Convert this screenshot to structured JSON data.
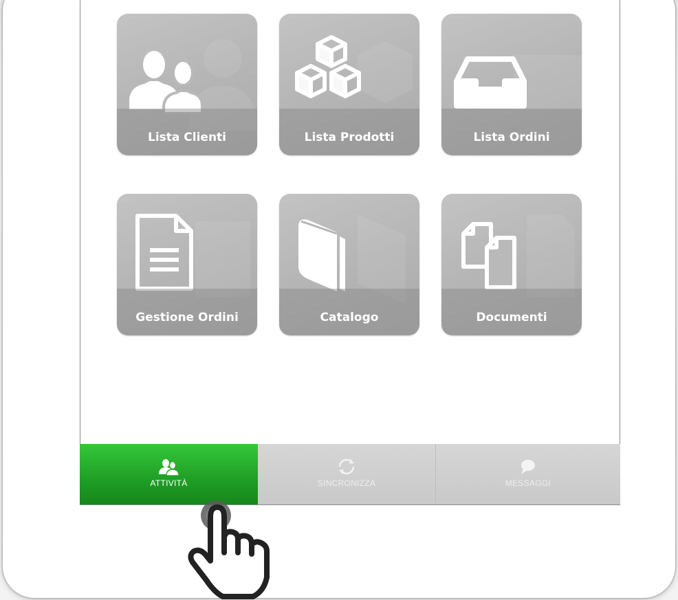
{
  "tiles": [
    {
      "label": "Lista Clienti",
      "icon": "users-icon"
    },
    {
      "label": "Lista Prodotti",
      "icon": "boxes-icon"
    },
    {
      "label": "Lista Ordini",
      "icon": "inbox-tray-icon"
    },
    {
      "label": "Gestione Ordini",
      "icon": "document-icon"
    },
    {
      "label": "Catalogo",
      "icon": "book-icon"
    },
    {
      "label": "Documenti",
      "icon": "copy-documents-icon"
    }
  ],
  "tabbar": {
    "tabs": [
      {
        "label": "ATTIVITÀ",
        "icon": "users-icon",
        "active": true
      },
      {
        "label": "SINCRONIZZA",
        "icon": "sync-icon",
        "active": false
      },
      {
        "label": "MESSAGGI",
        "icon": "chat-bubble-icon",
        "active": false
      }
    ]
  },
  "colors": {
    "active_tab": "#2db634",
    "tile": "#b8b8b8",
    "tabbar": "#cfcfcf"
  }
}
